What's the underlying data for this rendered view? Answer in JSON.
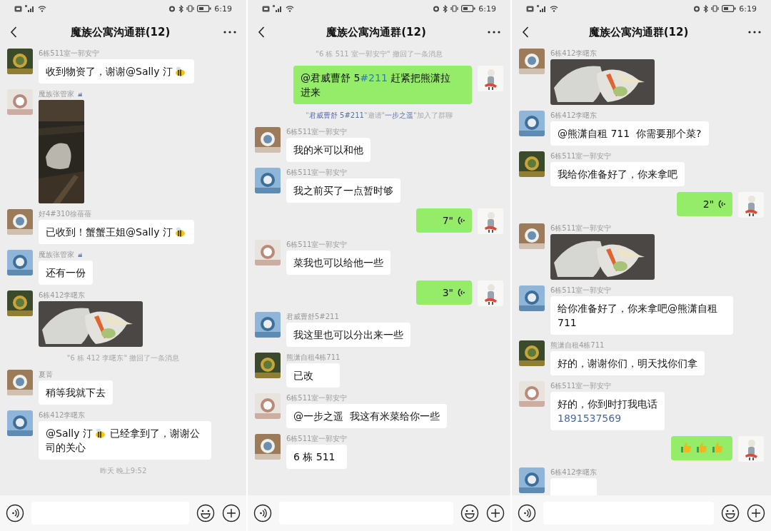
{
  "panels": [
    {
      "status_bar": {
        "time": "6:19"
      },
      "title": "魔族公寓沟通群(12)",
      "messages": [
        {
          "kind": "text",
          "sender": "6栋511室一郭安宁",
          "parts": [
            {
              "kind": "text",
              "text": "收到物资了，谢谢@Sally 汀"
            },
            {
              "kind": "bee"
            }
          ]
        },
        {
          "kind": "tall_image",
          "sender": "魔族张管家",
          "tag": true
        },
        {
          "kind": "text",
          "sender": "好4#310徐蓓蓓",
          "parts": [
            {
              "kind": "text",
              "text": "已收到！蟹蟹王姐@Sally 汀"
            },
            {
              "kind": "bee"
            }
          ]
        },
        {
          "kind": "text",
          "sender": "魔族张管家",
          "tag": true,
          "parts": [
            {
              "kind": "text",
              "text": "还有一份"
            }
          ]
        },
        {
          "sender": "6栋412李曙东"
        },
        {
          "kind": "system",
          "parts": [
            {
              "kind": "text",
              "text": "\"6 栋 412 李曙东\" 撤回了一条消息"
            }
          ]
        },
        {
          "kind": "text",
          "sender": "夏菁",
          "parts": [
            {
              "kind": "text",
              "text": "稍等我就下去"
            }
          ]
        },
        {
          "kind": "text",
          "sender": "6栋412李曙东",
          "parts": [
            {
              "kind": "text",
              "text": "@Sally 汀"
            },
            {
              "kind": "bee"
            },
            {
              "kind": "text",
              "text": " 已经拿到了，谢谢公"
            },
            {
              "kind": "text",
              "text": "司的关心"
            }
          ]
        },
        {
          "kind": "time",
          "text": "昨天 晚上9:52"
        }
      ]
    },
    {
      "status_bar": {
        "time": "6:19"
      },
      "title": "魔族公寓沟通群(12)",
      "messages": [
        {
          "kind": "system",
          "parts": [
            {
              "kind": "text",
              "text": "\"6 栋 511 室一郭安宁\" 撤回了一条消息"
            }
          ]
        },
        {
          "kind": "outgoing",
          "parts": [
            {
              "kind": "text",
              "text": "@君威曹舒 5"
            },
            {
              "kind": "link",
              "text": "#211"
            },
            {
              "kind": "text",
              "text": " 赶紧把熊潇拉"
            },
            {
              "kind": "text",
              "text": "进来"
            }
          ]
        },
        {
          "kind": "system",
          "parts": [
            {
              "kind": "text",
              "text": "\""
            },
            {
              "kind": "name",
              "text": "君威曹舒 5#211"
            },
            {
              "kind": "text",
              "text": "\"邀请\""
            },
            {
              "kind": "name",
              "text": "一步之遥"
            },
            {
              "kind": "text",
              "text": "\"加入了群聊"
            }
          ]
        },
        {
          "kind": "text",
          "sender": "6栋511室一郭安宁",
          "parts": [
            {
              "kind": "text",
              "text": "我的米可以和他"
            }
          ]
        },
        {
          "kind": "text",
          "sender": "6栋511室一郭安宁",
          "parts": [
            {
              "kind": "text",
              "text": "我之前买了一点暂时够"
            }
          ]
        },
        {
          "kind": "voice",
          "duration": "7\""
        },
        {
          "kind": "text",
          "sender": "6栋511室一郭安宁",
          "parts": [
            {
              "kind": "text",
              "text": "菜我也可以给他一些"
            }
          ]
        },
        {
          "kind": "voice",
          "duration": "3\""
        },
        {
          "kind": "text",
          "sender": "君威曹舒5#211",
          "parts": [
            {
              "kind": "text",
              "text": "我这里也可以分出来一些"
            }
          ]
        },
        {
          "kind": "text",
          "sender": "熊潇自租4栋711",
          "parts": [
            {
              "kind": "text",
              "text": "已改"
            }
          ]
        },
        {
          "kind": "text",
          "sender": "6栋511室一郭安宁",
          "parts": [
            {
              "kind": "text",
              "text": "@一步之遥  我这有米菜给你一些"
            }
          ]
        },
        {
          "kind": "text",
          "sender": "6栋511室一郭安宁",
          "parts": [
            {
              "kind": "text",
              "text": "6 栋 511"
            }
          ]
        }
      ]
    },
    {
      "status_bar": {
        "time": "6:19"
      },
      "title": "魔族公寓沟通群(12)",
      "messages": [
        {
          "sender": "6栋412李曙东"
        },
        {
          "kind": "text",
          "sender": "6栋412李曙东",
          "parts": [
            {
              "kind": "text",
              "text": "@熊潇自租 711  你需要那个菜?"
            }
          ]
        },
        {
          "kind": "text",
          "sender": "6栋511室一郭安宁",
          "parts": [
            {
              "kind": "text",
              "text": "我给你准备好了，你来拿吧"
            }
          ]
        },
        {
          "kind": "voice",
          "duration": "2\""
        },
        {
          "sender": "6栋511室一郭安宁"
        },
        {
          "kind": "text",
          "sender": "6栋511室一郭安宁",
          "parts": [
            {
              "kind": "text",
              "text": "给你准备好了，你来拿吧@熊潇自租 711"
            }
          ]
        },
        {
          "kind": "text",
          "sender": "熊潇自租4栋711",
          "parts": [
            {
              "kind": "text",
              "text": "好的，谢谢你们，明天找你们拿"
            }
          ]
        },
        {
          "kind": "text",
          "sender": "6栋511室一郭安宁",
          "parts": [
            {
              "kind": "text",
              "text": "好的，你到时打我电话"
            },
            {
              "kind": "link",
              "text": "1891537569"
            }
          ]
        },
        {
          "kind": "outgoing",
          "parts": [
            {
              "kind": "thumbs_up"
            },
            {
              "kind": "thumbs_up"
            },
            {
              "kind": "thumbs_up"
            }
          ]
        },
        {
          "kind": "text",
          "sender": "6栋412李曙东"
        }
      ]
    }
  ]
}
